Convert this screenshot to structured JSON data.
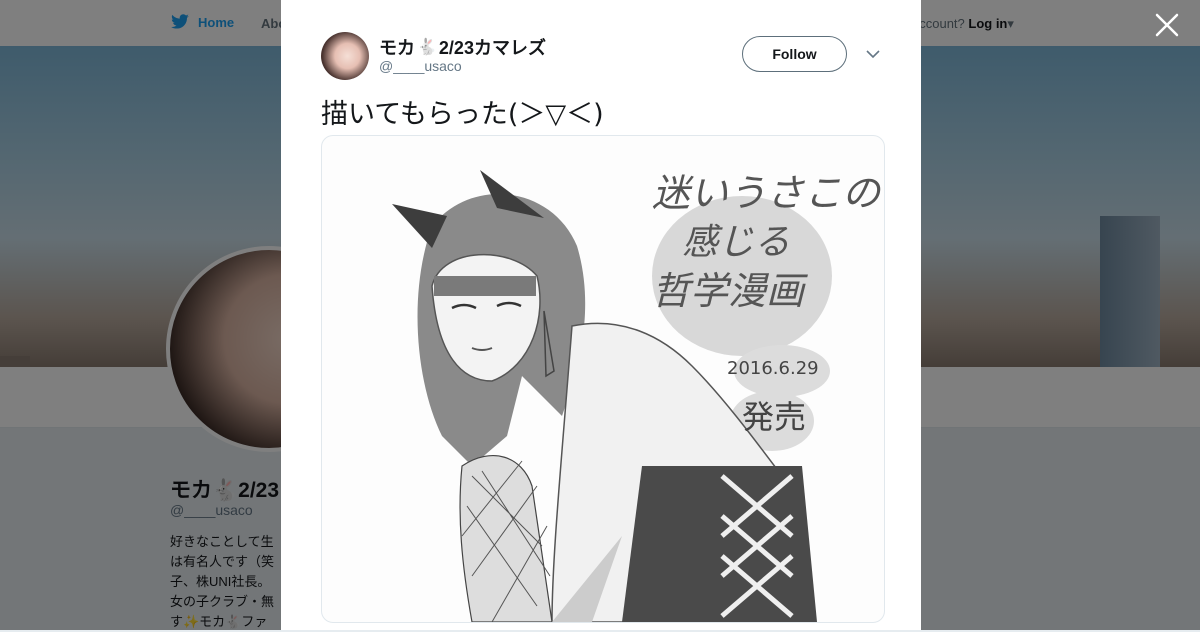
{
  "background_page": {
    "nav": {
      "home": "Home",
      "about": "Abo",
      "account_prompt": "account?",
      "login": "Log in"
    },
    "profile": {
      "name": "モカ🐇2/23",
      "handle": "@____usaco",
      "bio": "好きなことして生\nは有名人です（笑\n子、株UNI社長。\n女の子クラブ・無\nす✨モカ🐇ファ"
    }
  },
  "modal": {
    "author_name": "モカ",
    "author_name_suffix": "2/23カマレズ",
    "author_handle": "@____usaco",
    "follow_label": "Follow",
    "tweet_text": "描いてもらった(＞▽＜)",
    "image_text": {
      "line1": "迷いうさこの",
      "line2": "感じる",
      "line3": "哲学漫画",
      "date": "2016.6.29",
      "release": "発売"
    }
  },
  "colors": {
    "brand": "#1da1f2",
    "overlay": "rgba(0,0,0,0.5)"
  },
  "icons": [
    "twitter-bird-icon",
    "close-icon",
    "chevron-down-icon",
    "rabbit-emoji-icon"
  ]
}
